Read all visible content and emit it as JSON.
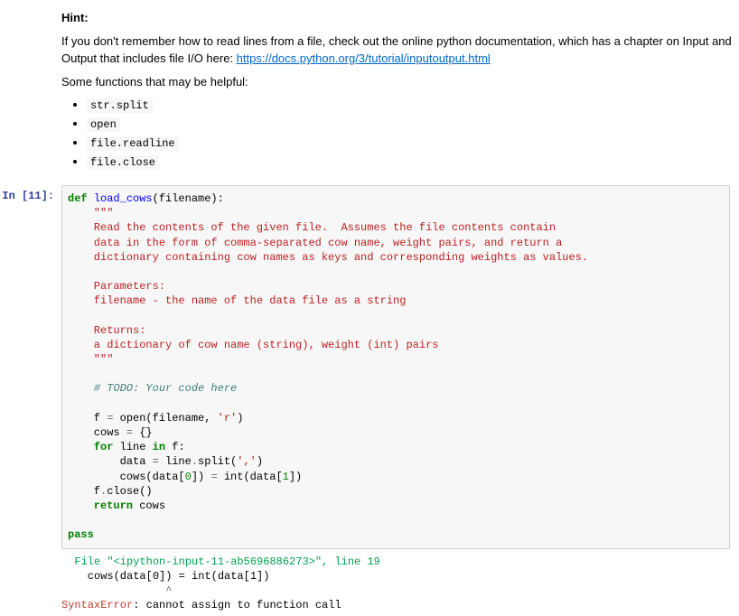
{
  "hint": {
    "heading": "Hint:",
    "intro_pre": "If you don't remember how to read lines from a file, check out the online python documentation, which has a chapter on Input and Output that includes file I/O here: ",
    "link_text": "https://docs.python.org/3/tutorial/inputoutput.html",
    "link_href": "https://docs.python.org/3/tutorial/inputoutput.html",
    "helpful_intro": "Some functions that may be helpful:",
    "funcs": [
      "str.split",
      "open",
      "file.readline",
      "file.close"
    ]
  },
  "cell": {
    "prompt_label": "In [11]:",
    "code": {
      "l01_def": "def ",
      "l01_name": "load_cows",
      "l01_rest": "(filename):",
      "l02": "    \"\"\"",
      "l03": "    Read the contents of the given file.  Assumes the file contents contain",
      "l04": "    data in the form of comma-separated cow name, weight pairs, and return a",
      "l05": "    dictionary containing cow names as keys and corresponding weights as values.",
      "l06": "",
      "l07": "    Parameters:",
      "l08": "    filename - the name of the data file as a string",
      "l09": "",
      "l10": "    Returns:",
      "l11": "    a dictionary of cow name (string), weight (int) pairs",
      "l12": "    \"\"\"",
      "l13": "    # TODO: Your code here",
      "l14": "",
      "l15a": "    f ",
      "l15b": "=",
      "l15c": " open(filename, ",
      "l15d": "'r'",
      "l15e": ")",
      "l16a": "    cows ",
      "l16b": "=",
      "l16c": " {}",
      "l17a": "    ",
      "l17kw": "for",
      "l17b": " line ",
      "l17kw2": "in",
      "l17c": " f:",
      "l18a": "        data ",
      "l18b": "=",
      "l18c": " line",
      "l18d": ".",
      "l18e": "split(",
      "l18f": "','",
      "l18g": ")",
      "l19a": "        cows(data[",
      "l19n0": "0",
      "l19b": "]) ",
      "l19eq": "=",
      "l19c": " int(data[",
      "l19n1": "1",
      "l19d": "])",
      "l20": "    f",
      "l20b": ".",
      "l20c": "close()",
      "l21kw": "    return",
      "l21b": " cows",
      "l22": "",
      "l23kw": "pass"
    }
  },
  "output": {
    "file_line": "  File \"<ipython-input-11-ab5696886273>\", line 19",
    "src_line": "    cows(data[0]) = int(data[1])",
    "caret": "                ^",
    "err_type": "SyntaxError",
    "err_sep": ": ",
    "err_msg": "cannot assign to function call"
  }
}
